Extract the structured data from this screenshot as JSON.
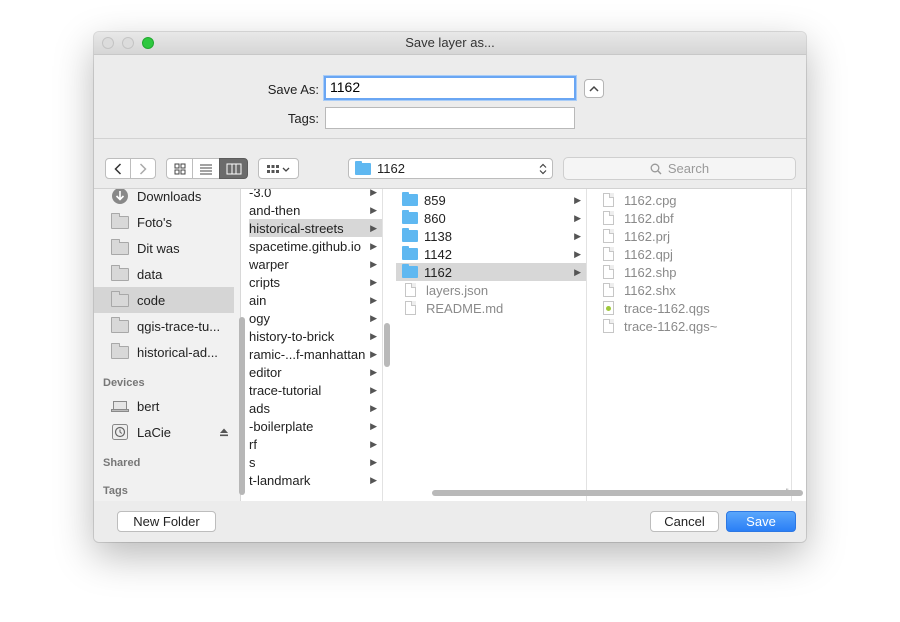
{
  "window": {
    "title": "Save layer as..."
  },
  "form": {
    "save_as_label": "Save As:",
    "save_as_value": "1162",
    "tags_label": "Tags:",
    "tags_value": ""
  },
  "toolbar": {
    "current_folder": "1162",
    "search_placeholder": "Search"
  },
  "sidebar": {
    "favorites": [
      {
        "label": "Downloads",
        "icon": "downloads-icon"
      },
      {
        "label": "Foto's",
        "icon": "folder-icon"
      },
      {
        "label": "Dit was",
        "icon": "folder-icon"
      },
      {
        "label": "data",
        "icon": "folder-icon"
      },
      {
        "label": "code",
        "icon": "folder-icon",
        "selected": true
      },
      {
        "label": "qgis-trace-tu...",
        "icon": "folder-icon"
      },
      {
        "label": "historical-ad...",
        "icon": "folder-icon"
      }
    ],
    "devices_header": "Devices",
    "devices": [
      {
        "label": "bert",
        "icon": "laptop-icon"
      },
      {
        "label": "LaCie",
        "icon": "external-drive-icon"
      }
    ],
    "shared_header": "Shared",
    "tags_header": "Tags"
  },
  "columns": {
    "code": [
      {
        "label": "-3.0"
      },
      {
        "label": "and-then"
      },
      {
        "label": "historical-streets",
        "selected": true
      },
      {
        "label": "spacetime.github.io"
      },
      {
        "label": "warper"
      },
      {
        "label": "cripts"
      },
      {
        "label": "ain"
      },
      {
        "label": "ogy"
      },
      {
        "label": "history-to-brick"
      },
      {
        "label": "ramic-...f-manhattan"
      },
      {
        "label": "editor"
      },
      {
        "label": "trace-tutorial"
      },
      {
        "label": "ads"
      },
      {
        "label": "-boilerplate"
      },
      {
        "label": "rf"
      },
      {
        "label": "s"
      },
      {
        "label": "t-landmark"
      }
    ],
    "historical_streets": [
      {
        "label": "859",
        "kind": "folder"
      },
      {
        "label": "860",
        "kind": "folder"
      },
      {
        "label": "1138",
        "kind": "folder"
      },
      {
        "label": "1142",
        "kind": "folder"
      },
      {
        "label": "1162",
        "kind": "folder",
        "selected": true
      },
      {
        "label": "layers.json",
        "kind": "file"
      },
      {
        "label": "README.md",
        "kind": "file"
      }
    ],
    "folder_1162": [
      {
        "label": "1162.cpg",
        "kind": "file"
      },
      {
        "label": "1162.dbf",
        "kind": "file"
      },
      {
        "label": "1162.prj",
        "kind": "file"
      },
      {
        "label": "1162.qpj",
        "kind": "file"
      },
      {
        "label": "1162.shp",
        "kind": "file"
      },
      {
        "label": "1162.shx",
        "kind": "file"
      },
      {
        "label": "trace-1162.qgs",
        "kind": "qgs"
      },
      {
        "label": "trace-1162.qgs~",
        "kind": "file"
      }
    ]
  },
  "buttons": {
    "new_folder": "New Folder",
    "cancel": "Cancel",
    "save": "Save"
  },
  "colors": {
    "accent": "#2a7ff6",
    "folder": "#5fb8f1",
    "close_light": "#dcdcdc",
    "zoom_light": "#2ec83f"
  }
}
